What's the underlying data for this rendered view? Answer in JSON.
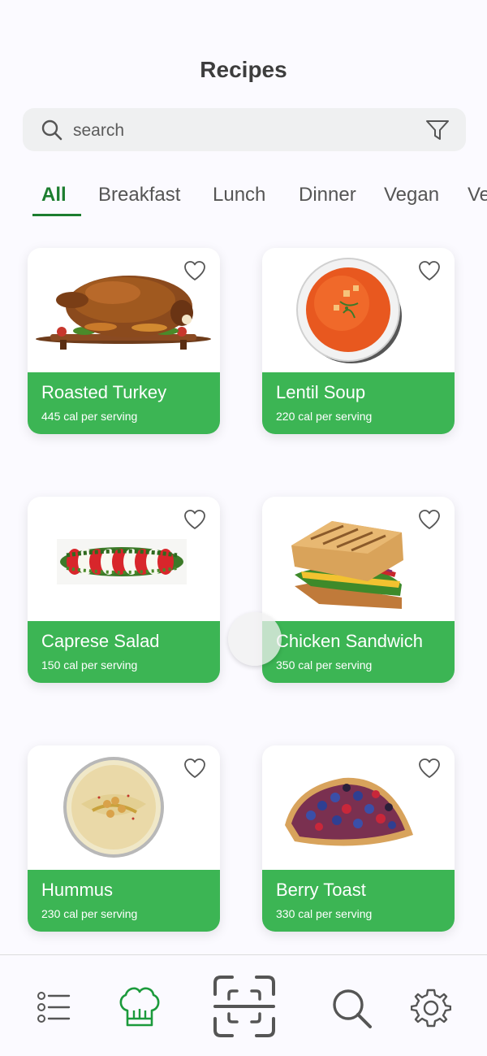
{
  "header": {
    "title": "Recipes"
  },
  "search": {
    "placeholder": "search"
  },
  "tabs": [
    {
      "label": "All",
      "active": true
    },
    {
      "label": "Breakfast"
    },
    {
      "label": "Lunch"
    },
    {
      "label": "Dinner"
    },
    {
      "label": "Vegan"
    },
    {
      "label": "Ve"
    }
  ],
  "recipes": [
    {
      "name": "Roasted Turkey",
      "calories": "445 cal per serving",
      "image": "roasted-turkey"
    },
    {
      "name": "Lentil Soup",
      "calories": "220 cal per serving",
      "image": "lentil-soup"
    },
    {
      "name": "Caprese Salad",
      "calories": "150 cal per serving",
      "image": "caprese-salad"
    },
    {
      "name": "Chicken Sandwich",
      "calories": "350 cal per serving",
      "image": "chicken-sandwich"
    },
    {
      "name": "Hummus",
      "calories": "230 cal per serving",
      "image": "hummus"
    },
    {
      "name": "Berry Toast",
      "calories": "330 cal per serving",
      "image": "berry-toast"
    }
  ],
  "nav": {
    "items": [
      {
        "icon": "list-icon"
      },
      {
        "icon": "chef-hat-icon",
        "active": true
      },
      {
        "icon": "scan-icon"
      },
      {
        "icon": "search-icon"
      },
      {
        "icon": "settings-gear-icon"
      }
    ]
  },
  "colors": {
    "accent": "#1c7d2f",
    "card_footer": "#3cb554",
    "background": "#fbfaff"
  }
}
